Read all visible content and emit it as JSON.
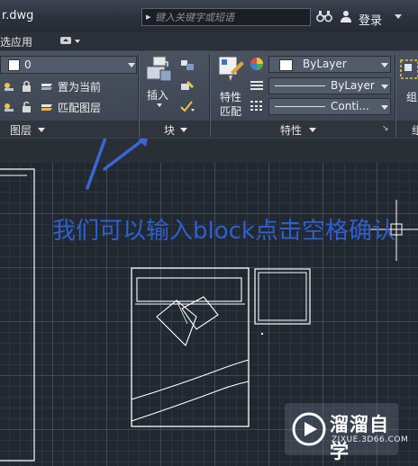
{
  "titlebar": {
    "file_name": "r.dwg",
    "search_placeholder": "键入关键字或短语",
    "login_label": "登录"
  },
  "tabs": {
    "selected_label": "选应用"
  },
  "ribbon": {
    "layers": {
      "current_layer": "0",
      "set_current_label": "置为当前",
      "match_layer_label": "匹配图层",
      "panel_label": "图层"
    },
    "block": {
      "insert_label": "插入",
      "panel_label": "块"
    },
    "properties": {
      "match_label_line1": "特性",
      "match_label_line2": "匹配",
      "color_value": "ByLayer",
      "linetype_value": "ByLayer",
      "lineweight_value": "Conti...",
      "panel_label": "特性"
    },
    "group": {
      "label": "组",
      "panel_label": "组"
    }
  },
  "drawing": {
    "annotation": "我们可以输入block点击空格确认"
  },
  "watermark": {
    "title": "溜溜自学",
    "url": "ZIXUE.3D66.COM"
  },
  "colors": {
    "annotation": "#2f5fd0",
    "canvas": "#212830",
    "ribbon": "#454c59"
  }
}
